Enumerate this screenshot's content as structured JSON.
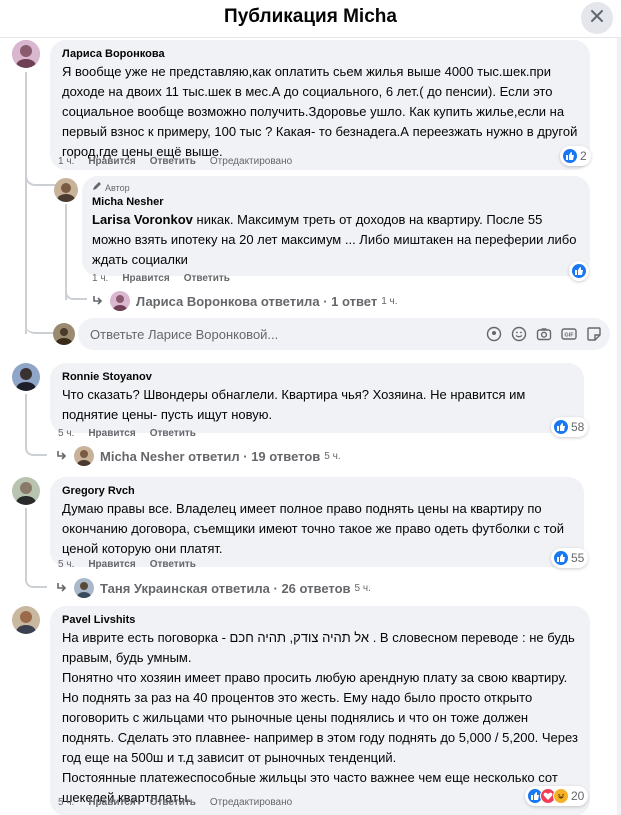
{
  "header": {
    "title": "Публикация Micha"
  },
  "comments": [
    {
      "author": "Лариса Воронкова",
      "text": "Я вообще уже не представляю,как оплатить сьем жилья выше 4000 тыс.шек.при доходе на двоих 11 тыс.шек в мес.А до социального, 6 лет.( до пенсии). Если это социальное вообще возможно получить.Здоровье ушло. Как купить жилье,если на первый взнос к примеру, 100 тыс ? Какая- то безнадега.А переезжать нужно в другой город,где цены ещё выше.",
      "time": "1 ч.",
      "like": "Нравится",
      "reply": "Ответить",
      "hide": "Отредактировано",
      "reactions": "2"
    },
    {
      "badge": "Автор",
      "author": "Micha Nesher",
      "mention": "Larisa Voronkov",
      "text": " никак. Максимум треть от доходов на квартиру. После 55 можно взять ипотеку на 20 лет максимум ... Либо миштакен на переферии либо ждать социалки",
      "time": "1 ч.",
      "like": "Нравится",
      "reply": "Ответить",
      "reactions": ""
    },
    {
      "author": "Ronnie Stoyanov",
      "text": "Что сказать? Швондеры обнаглели. Квартира чья? Хозяина. Не нравится им поднятие цены- пусть ищут новую.",
      "time": "5 ч.",
      "like": "Нравится",
      "reply": "Ответить",
      "reactions": "58"
    },
    {
      "author": "Gregory Rvch",
      "text": "Думаю правы все. Владелец имеет полное право поднять цены на квартиру по окончанию договора, съемщики имеют точно такое же право одеть футболки с той ценой которую они платят.",
      "time": "5 ч.",
      "like": "Нравится",
      "reply": "Ответить",
      "reactions": "55"
    },
    {
      "author": "Pavel Livshits",
      "text": "На иврите есть поговорка - אל תהיה צודק, תהיה חכם . В словесном переводе : не будь правым, будь умным.\nПонятно что хозяин имеет право просить любую арендную плату за свою квартиру. Но поднять за раз на 40 процентов это жесть. Ему надо было просто открыто поговорить с жильцами что рыночные цены поднялись и что он тоже должен поднять. Сделать это плавнее- например в этом году поднять до 5,000 / 5,200. Через год еще на 500ш и т.д зависит от рыночных тенденций.\nПостоянные платежеспособные жильцы это часто важнее чем еще несколько сот шекелей квартплаты.",
      "time": "5 ч.",
      "like": "Нравится",
      "reply": "Ответить",
      "hide": "Отредактировано",
      "reactions": "20"
    }
  ],
  "reply_summaries": [
    {
      "name": "Лариса Воронкова ответила",
      "count": "· 1 ответ",
      "time": "1 ч."
    },
    {
      "name": "Micha Nesher ответил",
      "count": "· 19 ответов",
      "time": "5 ч."
    },
    {
      "name": "Таня Украинская ответила",
      "count": "· 26 ответов",
      "time": "5 ч."
    }
  ],
  "reply_input": {
    "placeholder": "Ответьте Ларисе Воронковой..."
  },
  "colors": {
    "like": "#1877f2",
    "love": "#f33e58",
    "haha": "#f7b125",
    "bubble": "#f0f2f5",
    "muted": "#65676b"
  }
}
